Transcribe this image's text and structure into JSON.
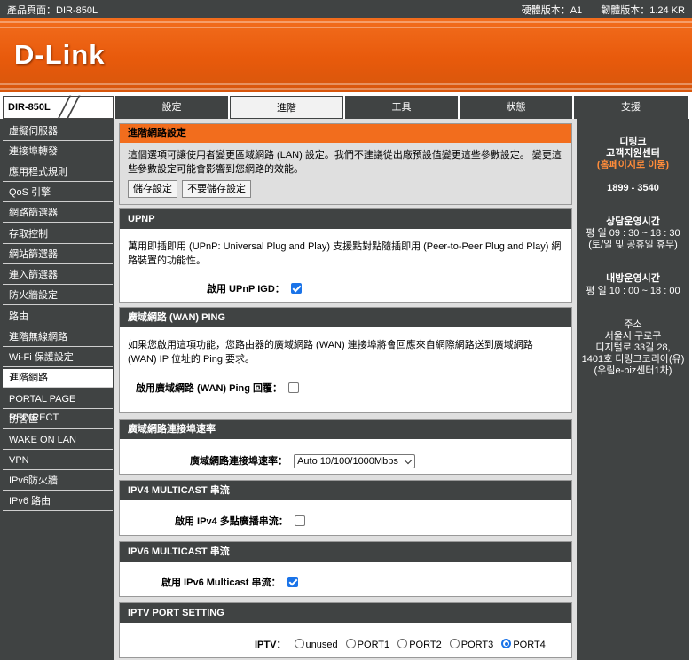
{
  "topbar": {
    "product": "產品頁面：DIR-850L",
    "hw_version": "硬體版本：A1",
    "fw_version": "韌體版本：1.24 KR"
  },
  "brand": {
    "logo": "D-Link"
  },
  "nav": {
    "model": "DIR-850L",
    "tabs": [
      "設定",
      "進階",
      "工具",
      "狀態",
      "支援"
    ],
    "active_tab": "進階"
  },
  "sidebar": {
    "items": [
      "虛擬伺服器",
      "連接埠轉發",
      "應用程式規則",
      "QoS 引擎",
      "網路篩選器",
      "存取控制",
      "網站篩選器",
      "連入篩選器",
      "防火牆設定",
      "路由",
      "進階無線網路",
      "Wi-Fi 保護設定",
      "進階網路",
      "PORTAL PAGE REDIRECT",
      "訪客區",
      "WAKE ON LAN",
      "VPN",
      "IPv6防火牆",
      "IPv6 路由"
    ],
    "active": "進階網路"
  },
  "intro": {
    "title": "進階網路設定",
    "text": "這個選項可讓使用者變更區域網路 (LAN) 設定。我們不建議從出廠預設值變更這些參數設定。 變更這些參數設定可能會影響到您網路的效能。",
    "save_label": "儲存設定",
    "dont_save_label": "不要儲存設定"
  },
  "upnp": {
    "title": "UPNP",
    "desc": "萬用即插即用 (UPnP: Universal Plug and Play) 支援點對點隨插即用 (Peer-to-Peer Plug and Play) 網路裝置的功能性。",
    "label": "啟用 UPnP IGD：",
    "checked": true
  },
  "wan_ping": {
    "title": "廣域網路 (WAN) PING",
    "desc": "如果您啟用這項功能，您路由器的廣域網路 (WAN) 連接埠將會回應來自網際網路送到廣域網路 (WAN) IP 位址的 Ping 要求。",
    "label": "啟用廣域網路 (WAN) Ping 回覆：",
    "checked": false
  },
  "wan_speed": {
    "title": "廣域網路連接埠速率",
    "label": "廣域網路連接埠速率：",
    "selected": "Auto 10/100/1000Mbps"
  },
  "ipv4_multicast": {
    "title": "IPV4 MULTICAST 串流",
    "label": "啟用 IPv4 多點廣播串流：",
    "checked": false
  },
  "ipv6_multicast": {
    "title": "IPV6 MULTICAST 串流",
    "label": "啟用 IPv6 Multicast 串流：",
    "checked": true
  },
  "iptv": {
    "title": "IPTV PORT SETTING",
    "label": "IPTV：",
    "options": [
      "unused",
      "PORT1",
      "PORT2",
      "PORT3",
      "PORT4"
    ],
    "selected": "PORT4"
  },
  "support": {
    "company": "디링크",
    "center": "고객지원센터",
    "homepage_link": "(홈페이지로 이동)",
    "phone": "1899 - 3540",
    "consult_title": "상담운영시간",
    "consult_hours": "평 일  09 : 30 ~ 18 : 30",
    "consult_note": "(토/일 및 공휴일 휴무)",
    "visit_title": "내방운영시간",
    "visit_hours": "평 일  10 : 00 ~ 18 : 00",
    "address_title": "주소",
    "address_line1": "서울시 구로구",
    "address_line2": "디지털로 33길 28,",
    "address_line3": "1401호 디링크코리아(유)",
    "address_line4": "(우림e-biz센터1차)"
  },
  "colors": {
    "brand_orange": "#f26d1d",
    "dark_gray": "#404343",
    "panel_gray": "#dfdfdf",
    "link_orange": "#ff8c3a"
  }
}
